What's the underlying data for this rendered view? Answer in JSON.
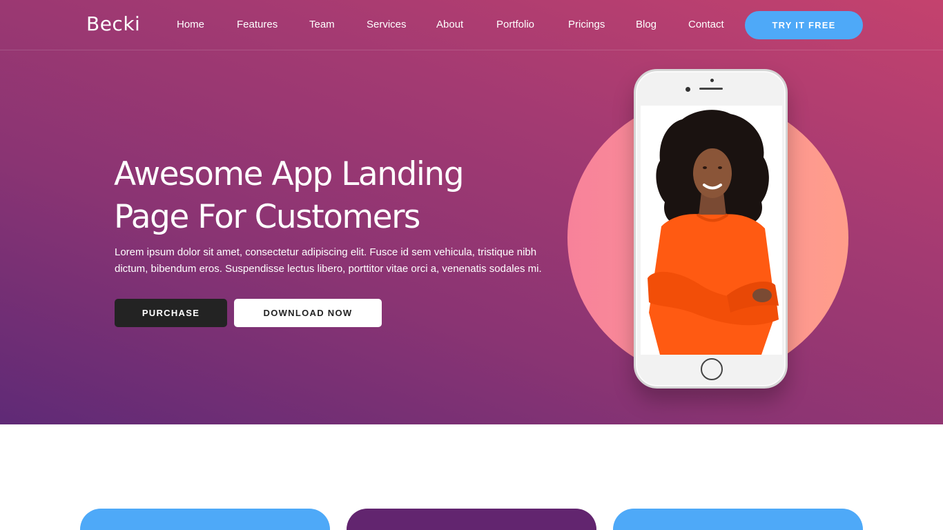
{
  "brand": {
    "logo_text": "Becki"
  },
  "nav": {
    "items": [
      {
        "label": "Home"
      },
      {
        "label": "Features"
      },
      {
        "label": "Team"
      },
      {
        "label": "Services"
      },
      {
        "label": "About"
      },
      {
        "label": "Portfolio"
      },
      {
        "label": "Pricings"
      },
      {
        "label": "Blog"
      },
      {
        "label": "Contact"
      }
    ],
    "cta_label": "TRY IT FREE"
  },
  "hero": {
    "title_line_1": "Awesome App Landing",
    "title_line_2": "Page For Customers",
    "subtitle": "Lorem ipsum dolor sit amet, consectetur adipiscing elit. Fusce id sem vehicula, tristique nibh dictum, bibendum eros. Suspendisse lectus libero, porttitor vitae orci a, venenatis sodales mi.",
    "primary_button": "PURCHASE",
    "secondary_button": "DOWNLOAD NOW"
  },
  "colors": {
    "accent_blue": "#4ea9f8",
    "hero_gradient_start": "#5f2a76",
    "hero_gradient_end": "#c4426e",
    "circle_pink": "#fd9596",
    "card_purple": "#62256f",
    "dark_button": "#232323"
  },
  "icons": {
    "phone": "smartphone-mockup"
  }
}
